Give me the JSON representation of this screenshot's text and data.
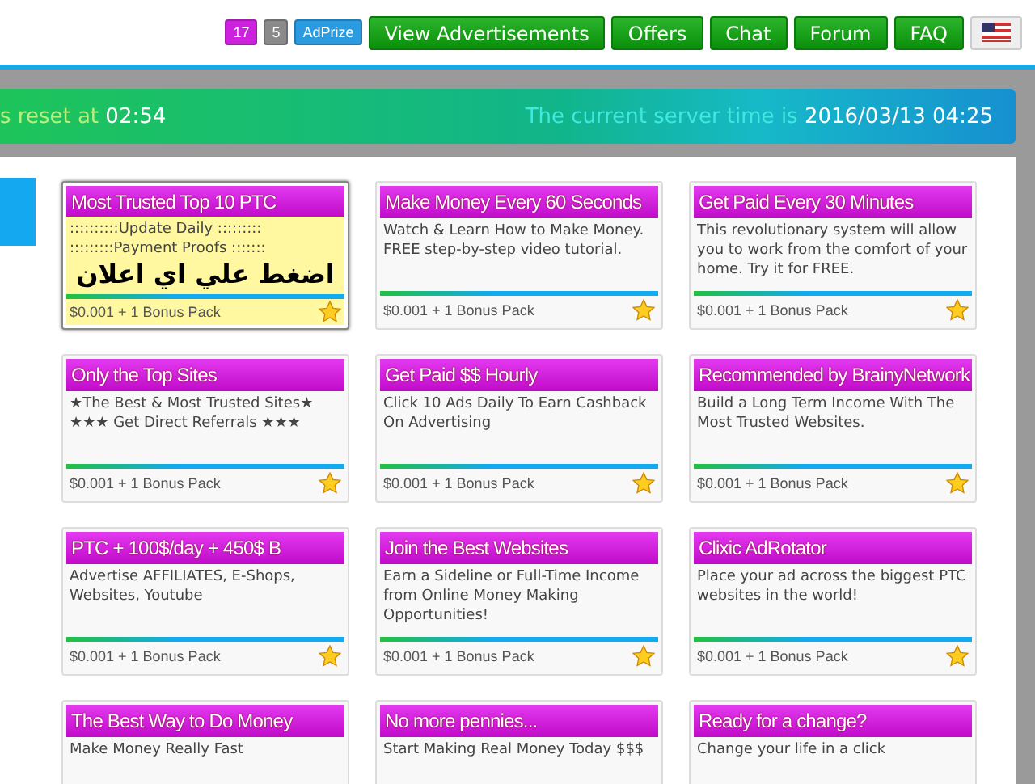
{
  "badges": [
    {
      "label": "17",
      "color": "#cc22dd"
    },
    {
      "label": "5",
      "color": "#8a8a8a"
    },
    {
      "label": "AdPrize",
      "color": "#2a9be0"
    }
  ],
  "nav": [
    "View Advertisements",
    "Offers",
    "Chat",
    "Forum",
    "FAQ"
  ],
  "banner": {
    "reset_label": "s reset at",
    "reset_time": "02:54",
    "server_label": "The current server time is",
    "server_time": "2016/03/13 04:25"
  },
  "ads": [
    {
      "title": "Most Trusted Top 10 PTC",
      "description": "::::::::::Update Daily ::::::::: :::::::::Payment Proofs :::::::",
      "arabic": "اضغط علي اي اعلان",
      "highlighted": true,
      "price": "$0.001 + 1 Bonus Pack"
    },
    {
      "title": "Make Money Every 60 Seconds",
      "description": "Watch & Learn How to Make Money. FREE step-by-step video tutorial.",
      "highlighted": false,
      "price": "$0.001 + 1 Bonus Pack"
    },
    {
      "title": "Get Paid Every 30 Minutes",
      "description": "This revolutionary system will allow you to work from the comfort of your home. Try it for FREE.",
      "highlighted": false,
      "price": "$0.001 + 1 Bonus Pack"
    },
    {
      "title": "Only the Top Sites",
      "description": "★The Best & Most Trusted Sites★ ★★★ Get Direct Referrals ★★★",
      "highlighted": false,
      "price": "$0.001 + 1 Bonus Pack"
    },
    {
      "title": "Get Paid $$ Hourly",
      "description": "Click 10 Ads Daily To Earn Cashback On Advertising",
      "highlighted": false,
      "price": "$0.001 + 1 Bonus Pack"
    },
    {
      "title": "Recommended by BrainyNetwork",
      "description": "Build a Long Term Income With The Most Trusted Websites.",
      "highlighted": false,
      "price": "$0.001 + 1 Bonus Pack"
    },
    {
      "title": "PTC + 100$/day + 450$ B",
      "description": "Advertise AFFILIATES, E-Shops, Websites, Youtube",
      "highlighted": false,
      "price": "$0.001 + 1 Bonus Pack"
    },
    {
      "title": "Join the Best Websites",
      "description": "Earn a Sideline or Full-Time Income from Online Money Making Opportunities!",
      "highlighted": false,
      "price": "$0.001 + 1 Bonus Pack"
    },
    {
      "title": "Clixic AdRotator",
      "description": "Place your ad across the biggest PTC websites in the world!",
      "highlighted": false,
      "price": "$0.001 + 1 Bonus Pack"
    },
    {
      "title": "The Best Way to Do Money",
      "description": "Make Money Really Fast",
      "highlighted": false
    },
    {
      "title": "No more pennies...",
      "description": "Start Making Real Money Today $$$",
      "highlighted": false
    },
    {
      "title": "Ready for a change?",
      "description": "Change your life in a click",
      "highlighted": false
    }
  ]
}
